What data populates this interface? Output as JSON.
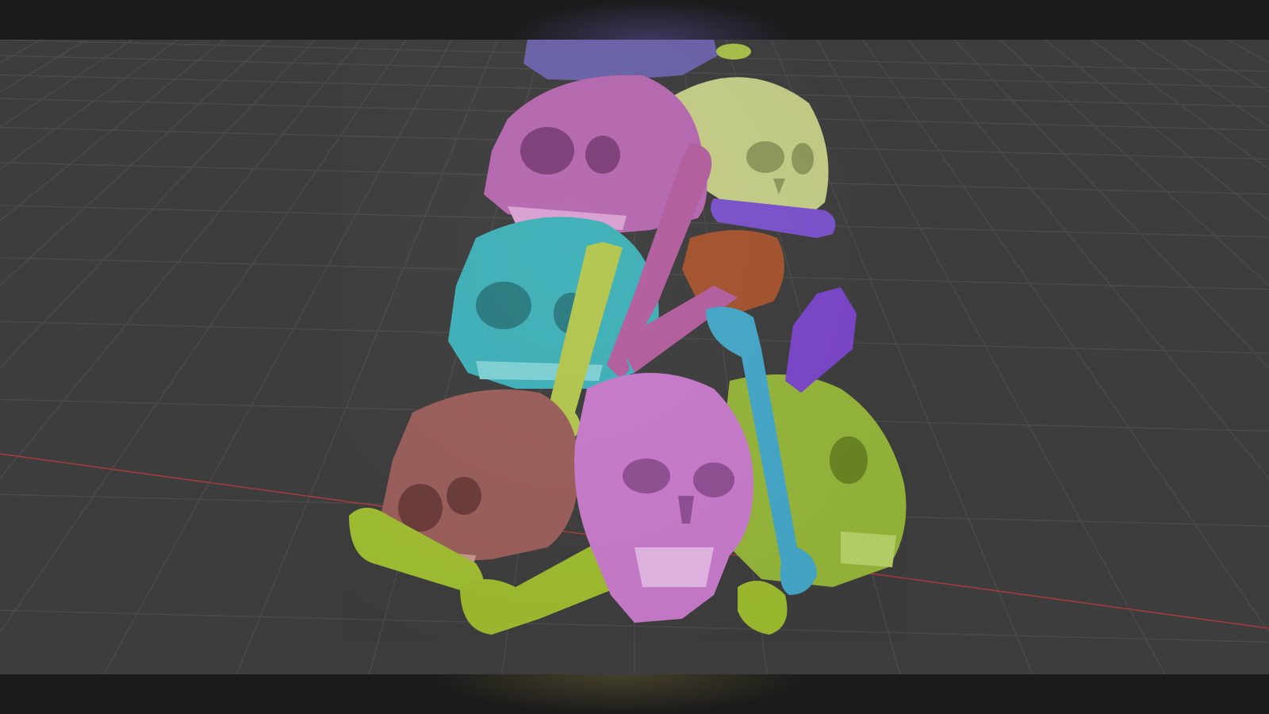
{
  "viewport": {
    "background": "#3d3d3d",
    "grid_color": "#4a4a4a",
    "x_axis_color": "#b33a3a",
    "letterbox_color": "#1b1b1b"
  },
  "scene": {
    "objects": [
      {
        "name": "skull-magenta-top",
        "color": "#b668b0"
      },
      {
        "name": "skull-yellow-green",
        "color": "#c3cc86"
      },
      {
        "name": "skull-cyan",
        "color": "#3fb0b8"
      },
      {
        "name": "skull-brown",
        "color": "#9a5e5a"
      },
      {
        "name": "skull-pink-front",
        "color": "#c77ac9"
      },
      {
        "name": "skull-lime",
        "color": "#94b53a"
      },
      {
        "name": "bone-cyan",
        "color": "#45a6c8"
      },
      {
        "name": "bone-yellow-green",
        "color": "#b3c64e"
      },
      {
        "name": "bone-pink",
        "color": "#b35e9e"
      },
      {
        "name": "bone-purple",
        "color": "#7a45c8"
      },
      {
        "name": "fragment-orange",
        "color": "#a4532e"
      },
      {
        "name": "fragment-lavender-top",
        "color": "#6a62a8"
      }
    ]
  }
}
